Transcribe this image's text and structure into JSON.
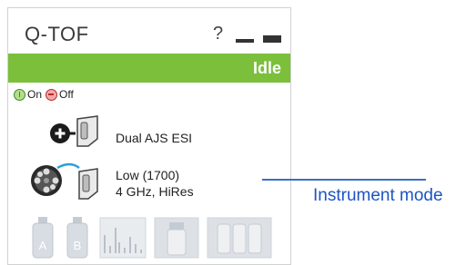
{
  "panel": {
    "title": "Q-TOF",
    "help_label": "?",
    "status": "Idle",
    "status_color": "#7bbf3b",
    "on_label": "On",
    "off_label": "Off"
  },
  "ion_source": {
    "label": "Dual AJS ESI",
    "icon": "ion-source-icon"
  },
  "instrument_mode": {
    "line1": "Low (1700)",
    "line2": "4 GHz, HiRes",
    "icon": "instrument-mode-icon"
  },
  "annotation": {
    "text": "Instrument mode",
    "color": "#1c54c2"
  },
  "bottom_icons": [
    {
      "name": "bottle-a-icon",
      "letter": "A"
    },
    {
      "name": "bottle-b-icon",
      "letter": "B"
    },
    {
      "name": "spectrum-icon"
    },
    {
      "name": "vial-icon"
    },
    {
      "name": "vial-tray-icon"
    }
  ]
}
